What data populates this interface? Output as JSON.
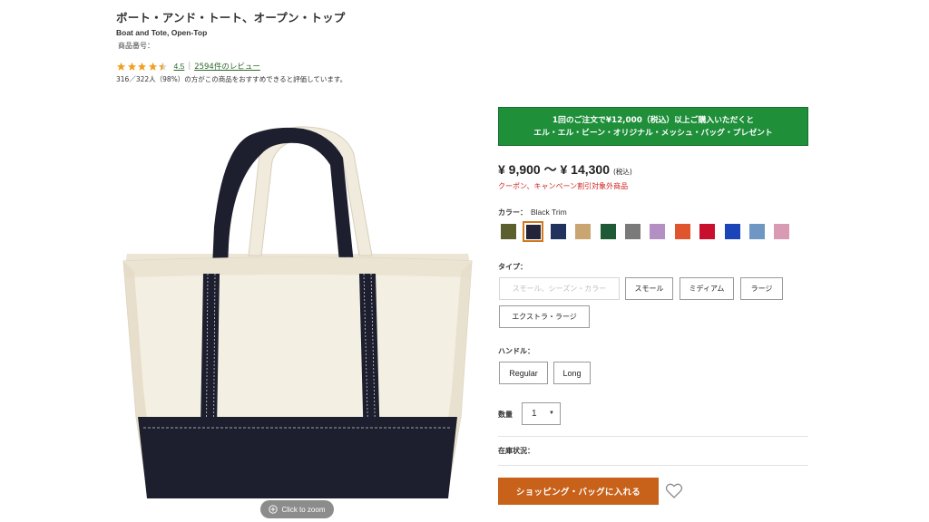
{
  "product": {
    "title": "ボート・アンド・トート、オープン・トップ",
    "subtitle": "Boat and Tote, Open-Top",
    "item_number_label": "商品番号：",
    "item_number_value": ""
  },
  "rating": {
    "score": "4.5",
    "stars_filled": 4.5,
    "stars_total": 5,
    "separator": "|",
    "reviews_link": "2594件のレビュー",
    "recommend_text": "316／322人（98%）の方がこの商品をおすすめできると評価しています。",
    "star_color": "#f0a020"
  },
  "image": {
    "zoom_label": "Click to zoom",
    "zoom_icon": "zoom-plus-icon"
  },
  "promo": {
    "line1": "1回のご注文で¥12,000（税込）以上ご購入いただくと",
    "line2": "エル・エル・ビーン・オリジナル・メッシュ・バッグ・プレゼント",
    "color": "#1f8f3a"
  },
  "price": {
    "range": "¥ 9,900 〜 ¥ 14,300",
    "tax_label": "(税込)",
    "coupon_note": "クーポン、キャンペーン割引対象外商品"
  },
  "color_selector": {
    "label": "カラー：",
    "selected_name": "Black Trim",
    "swatches": [
      "#5c5f2e",
      "#23243a",
      "#22325e",
      "#c8a571",
      "#1d5a35",
      "#7a7a7a",
      "#b48fc4",
      "#e0542e",
      "#c8102e",
      "#1a44b8",
      "#6f97c4",
      "#d99ab4"
    ],
    "selected_index": 1,
    "selected_border": "#d07a1e"
  },
  "type_selector": {
    "label": "タイプ：",
    "options": [
      "スモール、シーズン・カラー",
      "スモール",
      "ミディアム",
      "ラージ",
      "エクストラ・ラージ"
    ]
  },
  "handle_selector": {
    "label": "ハンドル：",
    "options": [
      "Regular",
      "Long"
    ]
  },
  "quantity": {
    "label": "数量",
    "value": "1",
    "arrow": "▼"
  },
  "stock": {
    "label": "在庫状況："
  },
  "cart": {
    "button_label": "ショッピング・バッグに入れる",
    "color": "#c8611a",
    "favorite_icon": "heart-icon"
  }
}
